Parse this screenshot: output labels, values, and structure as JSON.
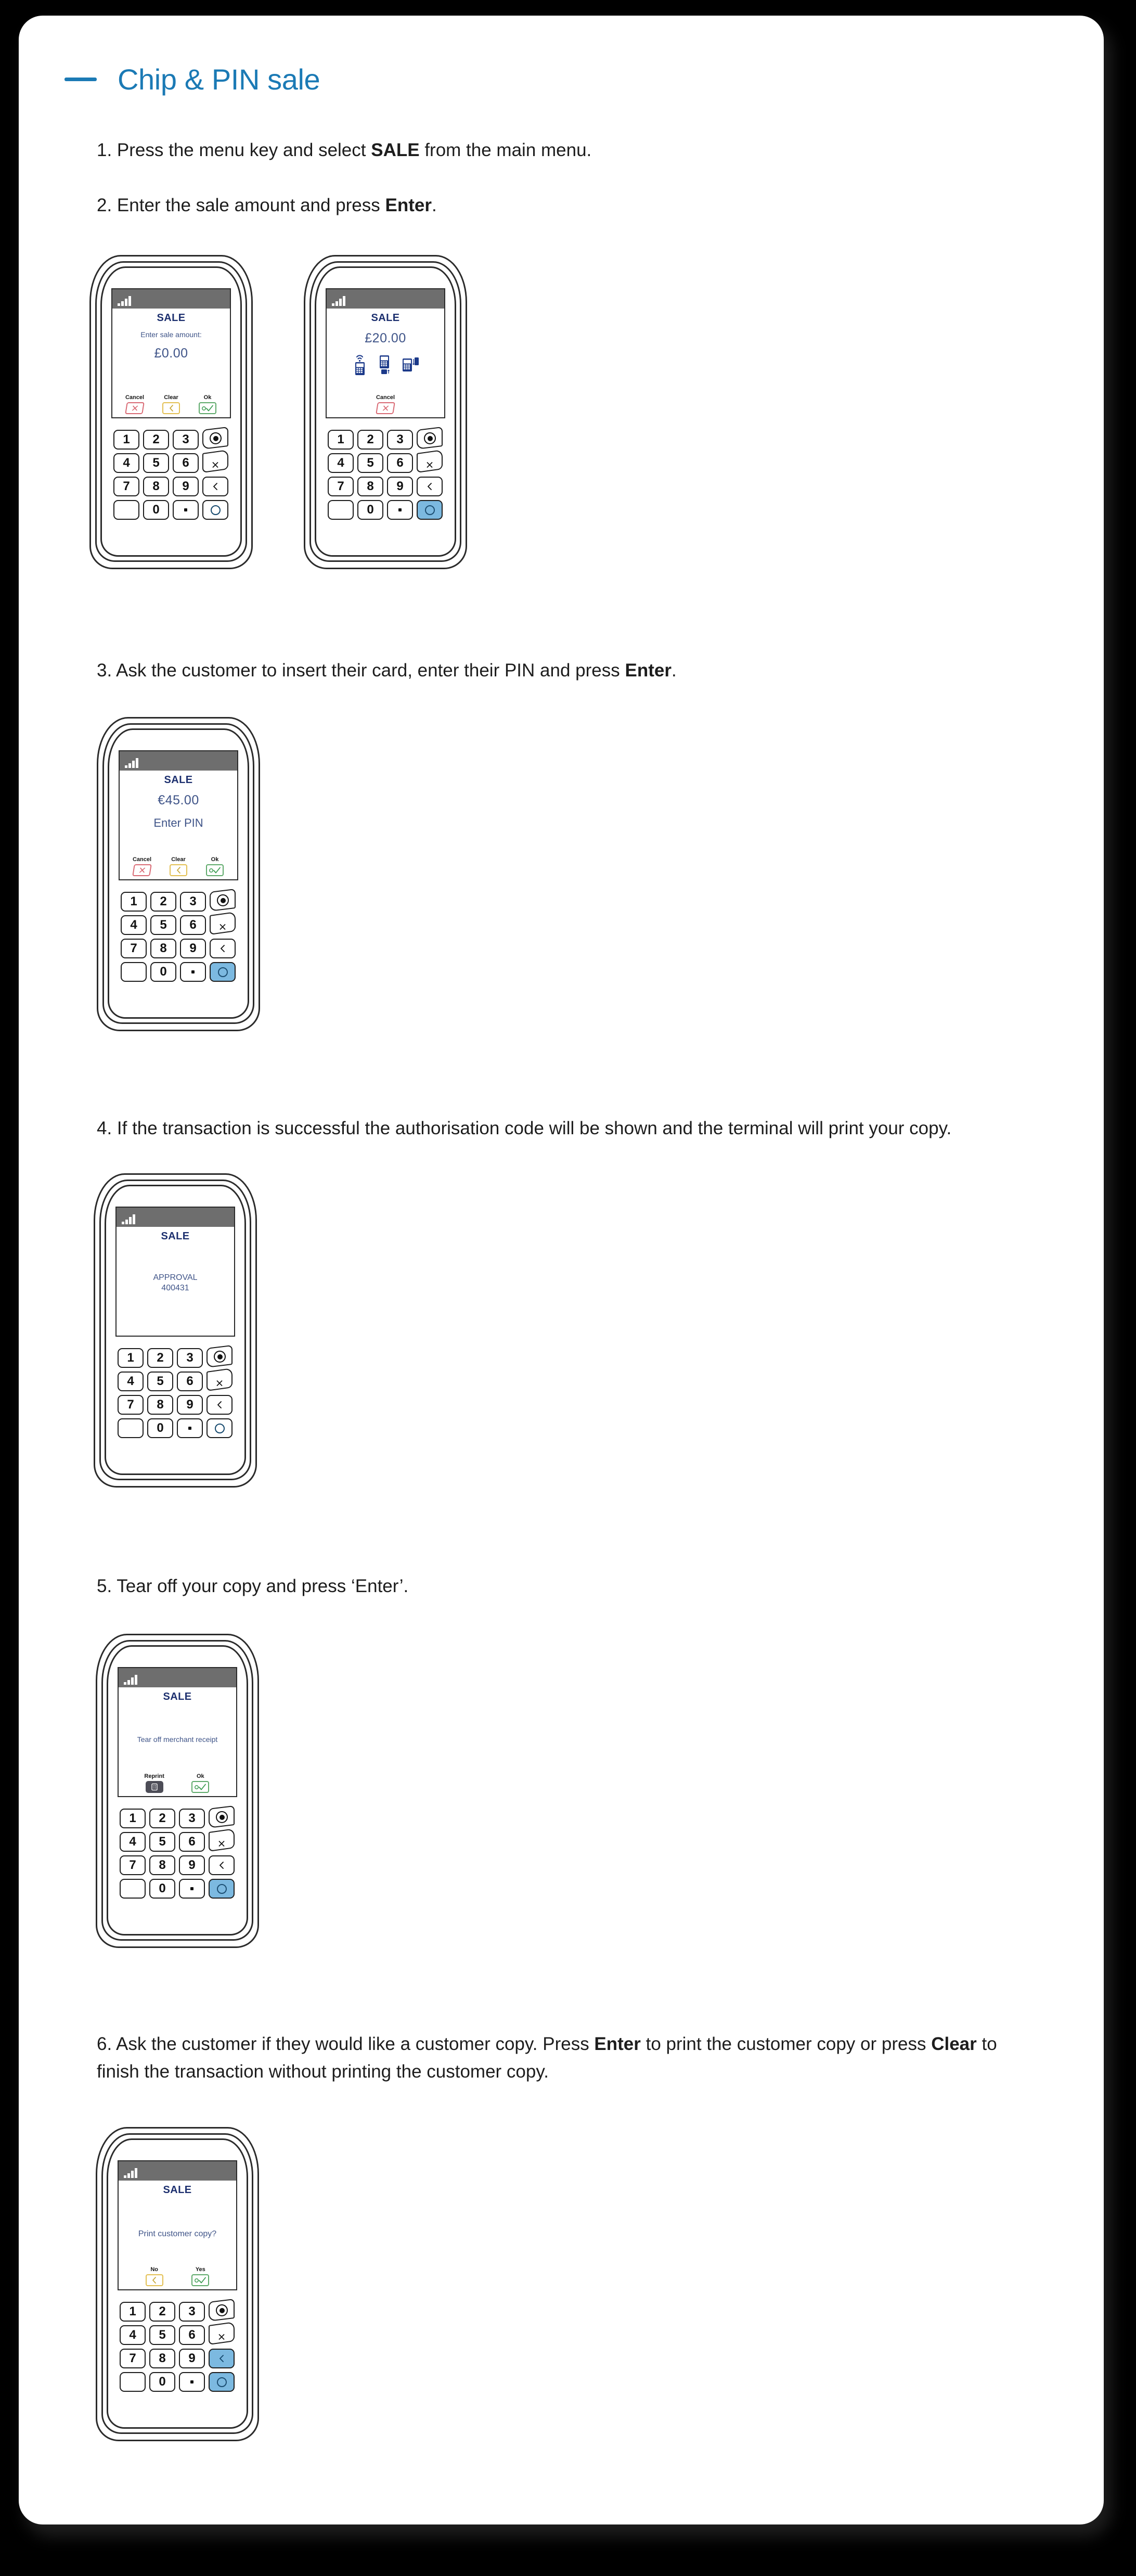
{
  "page": {
    "title": "Chip & PIN sale",
    "accent_color": "#1b7ab5",
    "heading_icon": "dash-icon"
  },
  "steps": [
    {
      "number": "1.",
      "parts": [
        {
          "text": "1. Press the menu key and select ",
          "bold": false
        },
        {
          "text": "SALE",
          "bold": true
        },
        {
          "text": " from the main menu.",
          "bold": false
        }
      ],
      "plain": "1. Press the menu key and select SALE from the main menu."
    },
    {
      "number": "2.",
      "plain": "2. Enter the sale amount and press Enter."
    },
    {
      "number": "3.",
      "plain": "3. Ask the customer to insert their card, enter their PIN and press Enter."
    },
    {
      "number": "4.",
      "plain": "4. If the transaction is successful the authorisation code will be shown and the terminal will print your copy."
    },
    {
      "number": "5.",
      "plain": "5. Tear off your copy and press ‘Enter’."
    },
    {
      "number": "6.",
      "plain": "6. Ask the customer if they would like a customer copy. Press Enter to print the customer copy or press Clear to finish the transaction without printing the customer copy."
    }
  ],
  "step_text": {
    "s1_a": "1. Press the menu key and select ",
    "s1_b": "SALE",
    "s1_c": " from the main menu.",
    "s2_a": "2. Enter the sale amount and press ",
    "s2_b": "Enter",
    "s2_c": ".",
    "s3_a": "3. Ask the customer to insert their card, enter their PIN and press ",
    "s3_b": "Enter",
    "s3_c": ".",
    "s4_a": "4. If the transaction is successful the authorisation code will be shown and the terminal will print your copy.",
    "s5_a": "5. Tear off your copy and press ‘Enter’.",
    "s6_a": "6. Ask the customer if they would like a customer copy. Press ",
    "s6_b": "Enter",
    "s6_c": " to print the customer copy or press ",
    "s6_d": "Clear",
    "s6_e": " to finish the transaction without printing the customer copy."
  },
  "keypad": {
    "keys": [
      "1",
      "2",
      "3",
      "4",
      "5",
      "6",
      "7",
      "8",
      "9",
      "0"
    ],
    "blank_label": "",
    "dot_label": ".",
    "menu_icon": "menu-bullseye-icon",
    "cancel_icon": "cancel-x-icon",
    "clear_icon": "clear-back-icon",
    "enter_icon": "enter-circle-icon",
    "highlight_color": "#7cb9e0"
  },
  "terminals": [
    {
      "id": "terminal-enter-amount",
      "status_icon": "signal-bars-icon",
      "title": "SALE",
      "prompt": "Enter sale amount:",
      "amount": "£0.00",
      "softkeys": [
        {
          "label": "Cancel",
          "icon": "cancel-x-icon"
        },
        {
          "label": "Clear",
          "icon": "clear-back-icon"
        },
        {
          "label": "Ok",
          "icon": "ok-check-icon"
        }
      ],
      "highlighted_keys": []
    },
    {
      "id": "terminal-present-card",
      "status_icon": "signal-bars-icon",
      "title": "SALE",
      "amount": "£20.00",
      "payment_icons": [
        "contactless-icon",
        "swipe-card-icon",
        "insert-card-icon"
      ],
      "softkeys": [
        {
          "label": "Cancel",
          "icon": "cancel-x-icon"
        }
      ],
      "highlighted_keys": [
        "enter"
      ]
    },
    {
      "id": "terminal-enter-pin",
      "status_icon": "signal-bars-icon",
      "title": "SALE",
      "amount": "€45.00",
      "message": "Enter PIN",
      "softkeys": [
        {
          "label": "Cancel",
          "icon": "cancel-x-icon"
        },
        {
          "label": "Clear",
          "icon": "clear-back-icon"
        },
        {
          "label": "Ok",
          "icon": "ok-check-icon"
        }
      ],
      "highlighted_keys": [
        "enter"
      ]
    },
    {
      "id": "terminal-approval",
      "status_icon": "signal-bars-icon",
      "title": "SALE",
      "approval_label": "APPROVAL",
      "approval_code": "400431",
      "softkeys": [],
      "highlighted_keys": []
    },
    {
      "id": "terminal-tear-off",
      "status_icon": "signal-bars-icon",
      "title": "SALE",
      "message": "Tear off merchant receipt",
      "softkeys": [
        {
          "label": "Reprint",
          "icon": "printer-icon"
        },
        {
          "label": "Ok",
          "icon": "ok-check-icon"
        }
      ],
      "highlighted_keys": [
        "enter"
      ]
    },
    {
      "id": "terminal-print-customer-copy",
      "status_icon": "signal-bars-icon",
      "title": "SALE",
      "message": "Print customer copy?",
      "softkeys": [
        {
          "label": "No",
          "icon": "clear-back-icon"
        },
        {
          "label": "Yes",
          "icon": "ok-check-icon"
        }
      ],
      "highlighted_keys": [
        "clear",
        "enter"
      ]
    }
  ]
}
